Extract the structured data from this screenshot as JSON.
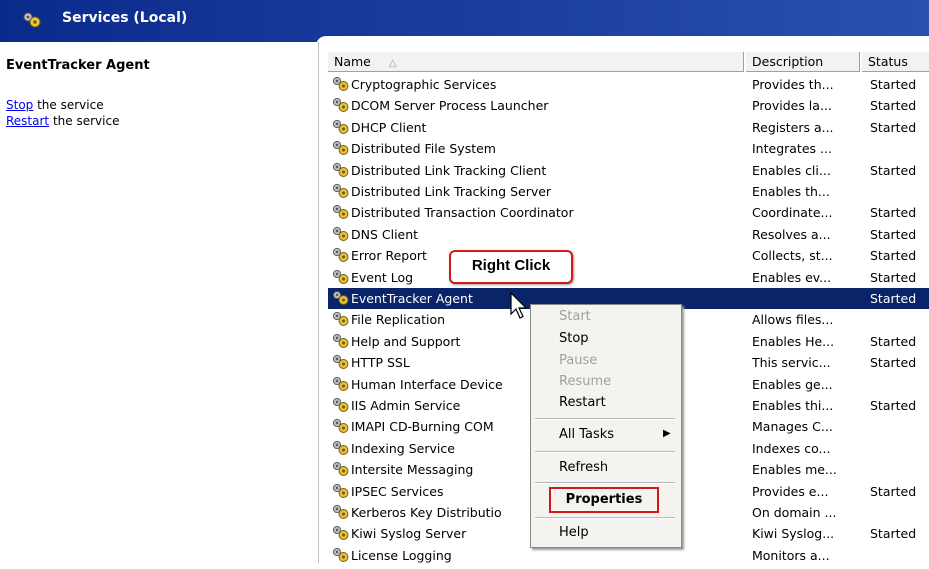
{
  "header": {
    "title": "Services (Local)",
    "icon": "services-gear-icon"
  },
  "left_pane": {
    "service_name": "EventTracker Agent",
    "actions": [
      {
        "link": "Stop",
        "rest": " the service"
      },
      {
        "link": "Restart",
        "rest": " the service"
      }
    ]
  },
  "columns": {
    "name": "Name",
    "sort_glyph": "△",
    "description": "Description",
    "status": "Status"
  },
  "rows": [
    {
      "name": "Cryptographic Services",
      "description": "Provides th...",
      "status": "Started"
    },
    {
      "name": "DCOM Server Process Launcher",
      "description": "Provides la...",
      "status": "Started"
    },
    {
      "name": "DHCP Client",
      "description": "Registers a...",
      "status": "Started"
    },
    {
      "name": "Distributed File System",
      "description": "Integrates ...",
      "status": ""
    },
    {
      "name": "Distributed Link Tracking Client",
      "description": "Enables cli...",
      "status": "Started"
    },
    {
      "name": "Distributed Link Tracking Server",
      "description": "Enables th...",
      "status": ""
    },
    {
      "name": "Distributed Transaction Coordinator",
      "description": "Coordinate...",
      "status": "Started"
    },
    {
      "name": "DNS Client",
      "description": "Resolves a...",
      "status": "Started"
    },
    {
      "name": "Error Report",
      "description": "Collects, st...",
      "status": "Started"
    },
    {
      "name": "Event Log",
      "description": "Enables ev...",
      "status": "Started"
    },
    {
      "name": "EventTracker Agent",
      "description": "",
      "status": "Started",
      "selected": true
    },
    {
      "name": "File Replication",
      "description": "Allows files...",
      "status": ""
    },
    {
      "name": "Help and Support",
      "description": "Enables He...",
      "status": "Started"
    },
    {
      "name": "HTTP SSL",
      "description": "This servic...",
      "status": "Started"
    },
    {
      "name": "Human Interface Device",
      "description": "Enables ge...",
      "status": ""
    },
    {
      "name": "IIS Admin Service",
      "description": "Enables thi...",
      "status": "Started"
    },
    {
      "name": "IMAPI CD-Burning COM",
      "description": "Manages C...",
      "status": ""
    },
    {
      "name": "Indexing Service",
      "description": "Indexes co...",
      "status": ""
    },
    {
      "name": "Intersite Messaging",
      "description": "Enables me...",
      "status": ""
    },
    {
      "name": "IPSEC Services",
      "description": "Provides e...",
      "status": "Started"
    },
    {
      "name": "Kerberos Key Distributio",
      "description": "On domain ...",
      "status": ""
    },
    {
      "name": "Kiwi Syslog Server",
      "description": "Kiwi Syslog...",
      "status": "Started"
    },
    {
      "name": "License Logging",
      "description": "Monitors a...",
      "status": ""
    }
  ],
  "context_menu": {
    "start": "Start",
    "stop": "Stop",
    "pause": "Pause",
    "resume": "Resume",
    "restart": "Restart",
    "all_tasks": "All Tasks",
    "all_tasks_arrow": "▶",
    "refresh": "Refresh",
    "properties": "Properties",
    "help": "Help"
  },
  "callout": {
    "text": "Right Click"
  },
  "colors": {
    "selection": "#0a246a",
    "titlebar": "#0b2b8c",
    "highlight": "#d11919"
  }
}
